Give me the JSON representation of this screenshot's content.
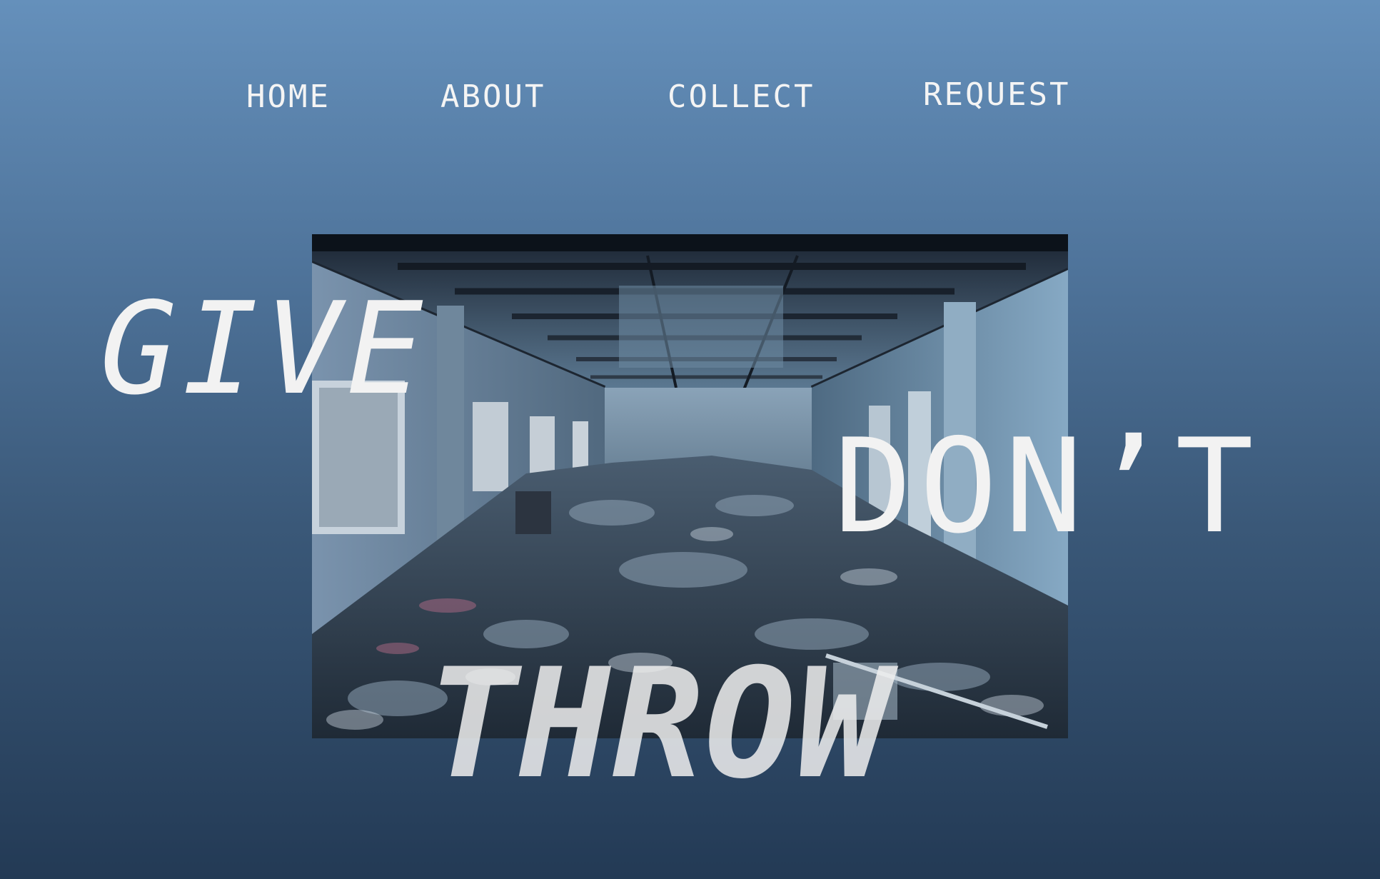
{
  "nav": {
    "items": [
      {
        "label": "HOME"
      },
      {
        "label": "ABOUT"
      },
      {
        "label": "COLLECT"
      },
      {
        "label": "REQUEST"
      }
    ]
  },
  "hero": {
    "image_icon": "photo-abandoned-room-with-trash",
    "words": {
      "give": "GIVE",
      "dont": "DON’T",
      "throw": "THROW"
    }
  },
  "colors": {
    "background_top": "#6590bb",
    "background_bottom": "#233a55",
    "text": "#f2f2f2"
  }
}
